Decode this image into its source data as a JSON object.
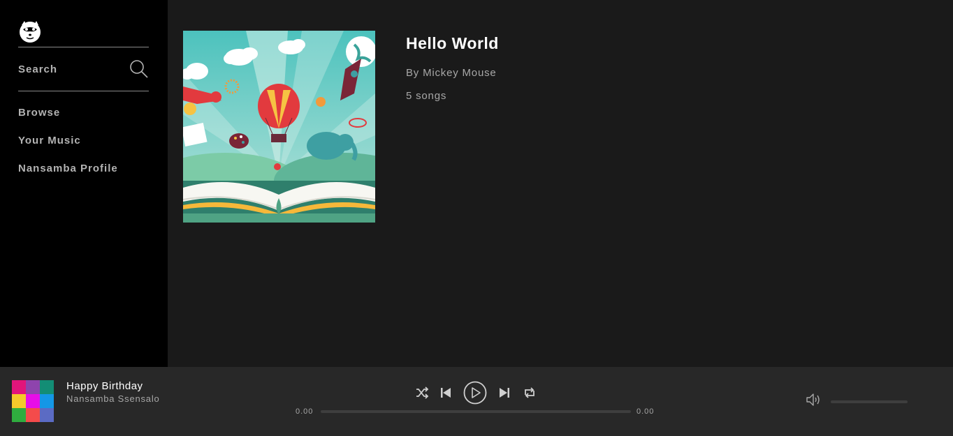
{
  "sidebar": {
    "search_label": "Search",
    "nav": [
      {
        "label": "Browse"
      },
      {
        "label": "Your Music"
      },
      {
        "label": "Nansamba Profile"
      }
    ]
  },
  "album": {
    "title": "Hello World",
    "artist": "By Mickey Mouse",
    "song_count": "5 songs"
  },
  "player": {
    "track_title": "Happy Birthday",
    "track_artist": "Nansamba Ssensalo",
    "elapsed": "0.00",
    "duration": "0.00",
    "progress": 0,
    "thumb_colors": [
      "#e2157b",
      "#8e44ad",
      "#138d75",
      "#f4c92b",
      "#e70ee8",
      "#1497e6",
      "#2fad3f",
      "#f44b4b",
      "#5b6bc4"
    ],
    "icons": [
      "shuffle-icon",
      "previous-icon",
      "play-icon",
      "next-icon",
      "repeat-icon",
      "volume-icon"
    ]
  },
  "theme": {
    "sidebar_bg": "#000000",
    "main_bg": "#1a1a1a",
    "player_bg": "#282828",
    "text_primary": "#ffffff",
    "text_secondary": "#a8a8a8"
  }
}
